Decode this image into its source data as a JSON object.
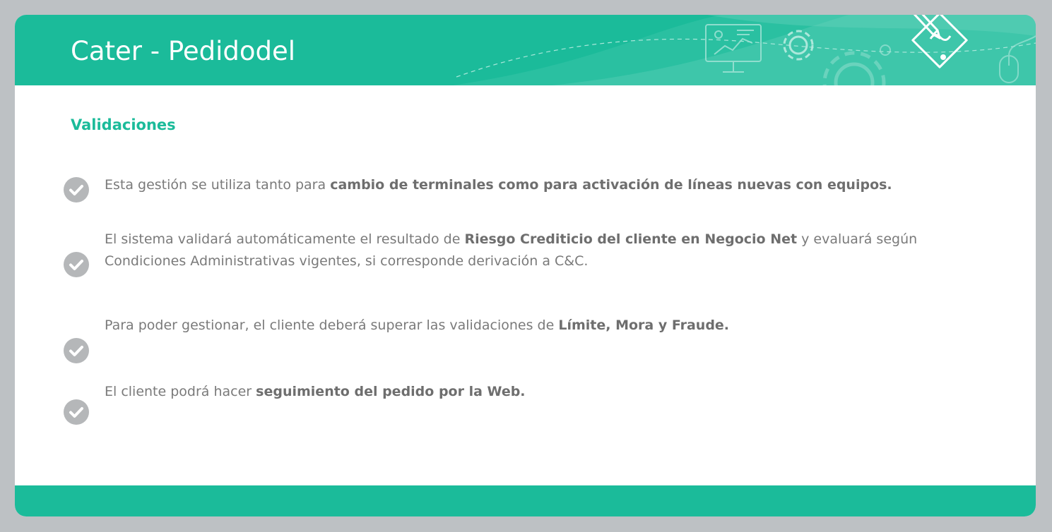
{
  "slide": {
    "title": "Cater - Pedidodel",
    "subtitle": "Validaciones",
    "colors": {
      "accent": "#1bbb9a",
      "background": "#bdc1c4",
      "text": "#7a7a7a",
      "check": "#b5b7b9"
    },
    "icons": [
      "monitor-chart-icon",
      "gear-icon",
      "pencil-paper-icon",
      "mouse-icon"
    ],
    "bullets": [
      {
        "icon": "check-circle-icon",
        "parts": [
          {
            "text": "Esta gestión se utiliza tanto para ",
            "bold": false
          },
          {
            "text": "cambio de terminales como para activación de líneas nuevas con equipos.",
            "bold": true
          }
        ]
      },
      {
        "icon": "check-circle-icon",
        "parts": [
          {
            "text": "El sistema validará automáticamente el resultado de ",
            "bold": false
          },
          {
            "text": "Riesgo Crediticio del cliente en Negocio Net",
            "bold": true
          },
          {
            "text": " y evaluará según Condiciones Administrativas vigentes, si corresponde derivación a C&C.",
            "bold": false
          }
        ]
      },
      {
        "icon": "check-circle-icon",
        "parts": [
          {
            "text": "Para poder gestionar, el cliente deberá superar las validaciones de ",
            "bold": false
          },
          {
            "text": "Límite, Mora y Fraude.",
            "bold": true
          }
        ]
      },
      {
        "icon": "check-circle-icon",
        "parts": [
          {
            "text": "El cliente podrá hacer ",
            "bold": false
          },
          {
            "text": "seguimiento del pedido por la Web.",
            "bold": true
          }
        ]
      }
    ]
  }
}
